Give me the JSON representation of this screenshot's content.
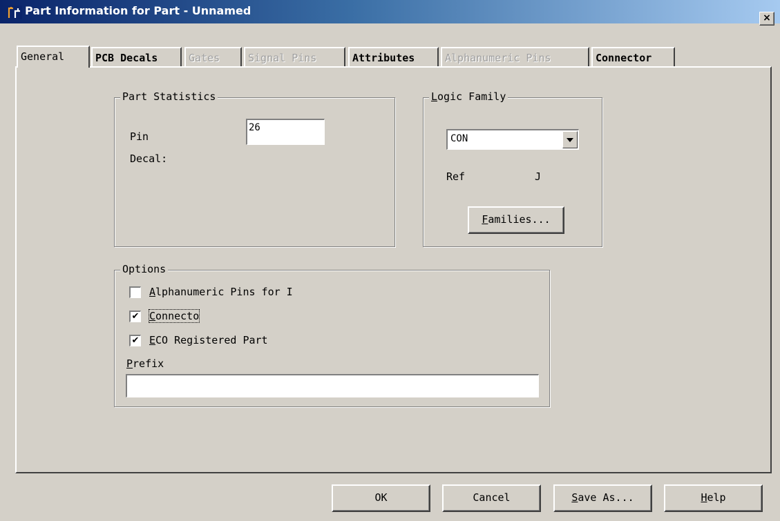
{
  "window": {
    "title": "Part Information for Part - Unnamed",
    "close_label": "×"
  },
  "tabs": [
    {
      "label": "General",
      "state": "active"
    },
    {
      "label": "PCB Decals",
      "state": "enabled"
    },
    {
      "label": "Gates",
      "state": "disabled"
    },
    {
      "label": "Signal Pins",
      "state": "disabled"
    },
    {
      "label": "Attributes",
      "state": "enabled"
    },
    {
      "label": "Alphanumeric Pins",
      "state": "disabled"
    },
    {
      "label": "Connector",
      "state": "enabled"
    }
  ],
  "part_statistics": {
    "title": "Part Statistics",
    "pin_label": "Pin",
    "pin_value": "26",
    "decal_label": "Decal:"
  },
  "logic_family": {
    "title_prefix": "",
    "title_mnemonic": "L",
    "title_rest": "ogic Family",
    "selected": "CON",
    "ref_label": "Ref",
    "ref_value": "J",
    "families_mnemonic": "F",
    "families_rest": "amilies..."
  },
  "options": {
    "title": "Options",
    "items": [
      {
        "mnemonic": "A",
        "rest": "lphanumeric Pins for I",
        "checked": false
      },
      {
        "mnemonic": "C",
        "rest": "onnecto",
        "checked": true
      },
      {
        "mnemonic": "E",
        "rest": "CO Registered Part",
        "checked": true
      }
    ],
    "prefix_mnemonic": "P",
    "prefix_rest": "refix",
    "prefix_value": ""
  },
  "buttons": {
    "ok": "OK",
    "cancel": "Cancel",
    "save_as_mnemonic": "S",
    "save_as_rest": "ave As...",
    "help_mnemonic": "H",
    "help_rest": "elp"
  },
  "check_glyph": "✔"
}
